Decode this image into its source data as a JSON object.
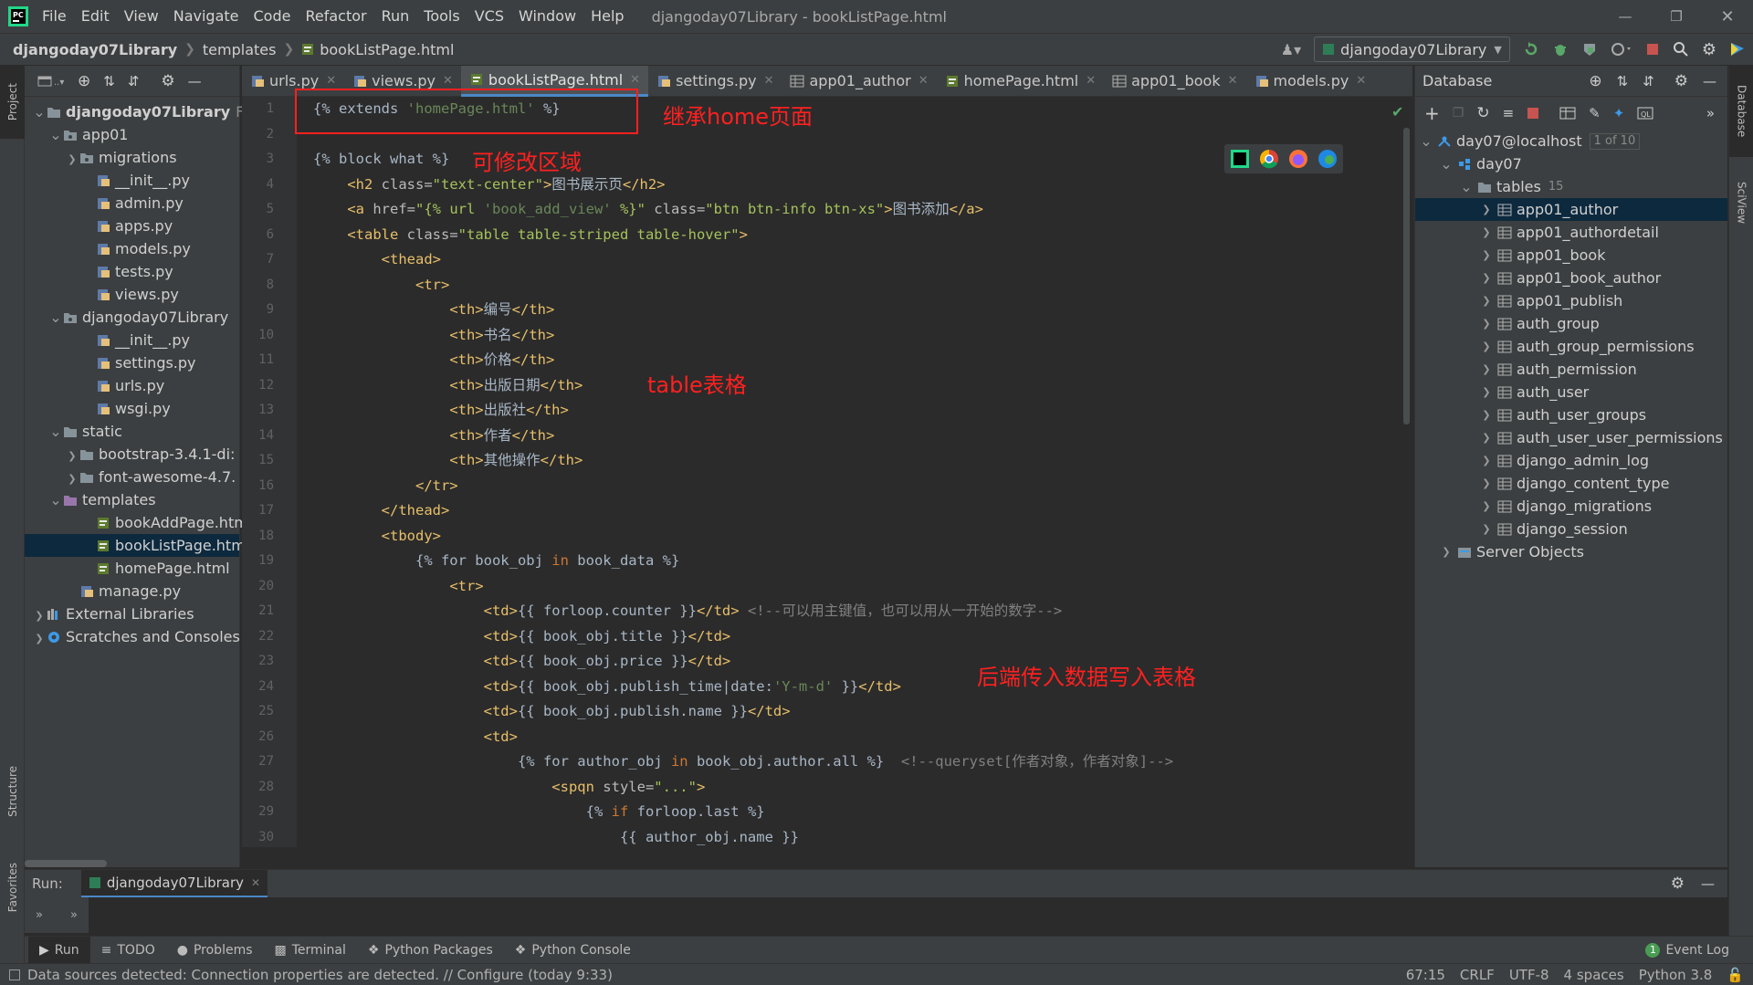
{
  "menu": [
    "File",
    "Edit",
    "View",
    "Navigate",
    "Code",
    "Refactor",
    "Run",
    "Tools",
    "VCS",
    "Window",
    "Help"
  ],
  "window_title": "djangoday07Library - bookListPage.html",
  "breadcrumb": [
    "djangoday07Library",
    "templates",
    "bookListPage.html"
  ],
  "run_config": "djangoday07Library",
  "left_strip": {
    "project": "Project",
    "structure": "Structure",
    "favorites": "Favorites"
  },
  "right_strip": {
    "database": "Database",
    "sciview": "SciView"
  },
  "project_tree": [
    {
      "label": "djangoday07Library",
      "suffix": "F:\\",
      "depth": 0,
      "arrow": "open",
      "icon": "folder-icon",
      "bold": true
    },
    {
      "label": "app01",
      "depth": 1,
      "arrow": "open",
      "icon": "package-icon"
    },
    {
      "label": "migrations",
      "depth": 2,
      "arrow": "closed",
      "icon": "package-icon"
    },
    {
      "label": "__init__.py",
      "depth": 3,
      "icon": "python-file-icon"
    },
    {
      "label": "admin.py",
      "depth": 3,
      "icon": "python-file-icon"
    },
    {
      "label": "apps.py",
      "depth": 3,
      "icon": "python-file-icon"
    },
    {
      "label": "models.py",
      "depth": 3,
      "icon": "python-file-icon"
    },
    {
      "label": "tests.py",
      "depth": 3,
      "icon": "python-file-icon"
    },
    {
      "label": "views.py",
      "depth": 3,
      "icon": "python-file-icon"
    },
    {
      "label": "djangoday07Library",
      "depth": 1,
      "arrow": "open",
      "icon": "package-icon"
    },
    {
      "label": "__init__.py",
      "depth": 3,
      "icon": "python-file-icon"
    },
    {
      "label": "settings.py",
      "depth": 3,
      "icon": "python-file-icon"
    },
    {
      "label": "urls.py",
      "depth": 3,
      "icon": "python-file-icon"
    },
    {
      "label": "wsgi.py",
      "depth": 3,
      "icon": "python-file-icon"
    },
    {
      "label": "static",
      "depth": 1,
      "arrow": "open",
      "icon": "folder-icon"
    },
    {
      "label": "bootstrap-3.4.1-di:",
      "depth": 2,
      "arrow": "closed",
      "icon": "folder-icon"
    },
    {
      "label": "font-awesome-4.7.",
      "depth": 2,
      "arrow": "closed",
      "icon": "folder-icon"
    },
    {
      "label": "templates",
      "depth": 1,
      "arrow": "open",
      "icon": "template-folder-icon"
    },
    {
      "label": "bookAddPage.htm",
      "depth": 3,
      "icon": "html-file-icon"
    },
    {
      "label": "bookListPage.html",
      "depth": 3,
      "icon": "html-file-icon",
      "selected": true
    },
    {
      "label": "homePage.html",
      "depth": 3,
      "icon": "html-file-icon"
    },
    {
      "label": "manage.py",
      "depth": 2,
      "icon": "python-file-icon"
    },
    {
      "label": "External Libraries",
      "depth": 0,
      "arrow": "closed",
      "icon": "library-icon"
    },
    {
      "label": "Scratches and Consoles",
      "depth": 0,
      "arrow": "closed",
      "icon": "scratches-icon"
    }
  ],
  "tabs": [
    {
      "label": "urls.py",
      "icon": "python-file-icon"
    },
    {
      "label": "views.py",
      "icon": "python-file-icon"
    },
    {
      "label": "bookListPage.html",
      "icon": "html-file-icon",
      "active": true
    },
    {
      "label": "settings.py",
      "icon": "python-file-icon"
    },
    {
      "label": "app01_author",
      "icon": "table-icon"
    },
    {
      "label": "homePage.html",
      "icon": "html-file-icon"
    },
    {
      "label": "app01_book",
      "icon": "table-icon"
    },
    {
      "label": "models.py",
      "icon": "python-file-icon"
    }
  ],
  "line_numbers": [
    "1",
    "2",
    "3",
    "4",
    "5",
    "6",
    "7",
    "8",
    "9",
    "10",
    "11",
    "12",
    "13",
    "14",
    "15",
    "16",
    "17",
    "18",
    "19",
    "20",
    "21",
    "22",
    "23",
    "24",
    "25",
    "26",
    "27",
    "28",
    "29",
    "30"
  ],
  "code_lines": [
    [
      [
        "t-tpl",
        "{% extends "
      ],
      [
        "t-str",
        "'homePage.html'"
      ],
      [
        "t-tpl",
        " %}"
      ]
    ],
    [],
    [
      [
        "t-tpl",
        "{% block what %}"
      ]
    ],
    [
      [
        "t-txt",
        "    "
      ],
      [
        "t-tag",
        "<h2 "
      ],
      [
        "t-attr",
        "class="
      ],
      [
        "t-val",
        "\"text-center\""
      ],
      [
        "t-tag",
        ">"
      ],
      [
        "t-txt",
        "图书展示页"
      ],
      [
        "t-tag",
        "</h2>"
      ]
    ],
    [
      [
        "t-txt",
        "    "
      ],
      [
        "t-tag",
        "<a "
      ],
      [
        "t-attr",
        "href="
      ],
      [
        "t-val",
        "\"{% url "
      ],
      [
        "t-str",
        "'book_add_view'"
      ],
      [
        "t-val",
        " %}\""
      ],
      [
        "t-attr",
        " class="
      ],
      [
        "t-val",
        "\"btn btn-info btn-xs\""
      ],
      [
        "t-tag",
        ">"
      ],
      [
        "t-txt",
        "图书添加"
      ],
      [
        "t-tag",
        "</a>"
      ]
    ],
    [
      [
        "t-txt",
        "    "
      ],
      [
        "t-tag",
        "<table "
      ],
      [
        "t-attr",
        "class="
      ],
      [
        "t-val",
        "\"table table-striped table-hover\""
      ],
      [
        "t-tag",
        ">"
      ]
    ],
    [
      [
        "t-txt",
        "        "
      ],
      [
        "t-tag",
        "<thead>"
      ]
    ],
    [
      [
        "t-txt",
        "            "
      ],
      [
        "t-tag",
        "<tr>"
      ]
    ],
    [
      [
        "t-txt",
        "                "
      ],
      [
        "t-tag",
        "<th>"
      ],
      [
        "t-txt",
        "编号"
      ],
      [
        "t-tag",
        "</th>"
      ]
    ],
    [
      [
        "t-txt",
        "                "
      ],
      [
        "t-tag",
        "<th>"
      ],
      [
        "t-txt",
        "书名"
      ],
      [
        "t-tag",
        "</th>"
      ]
    ],
    [
      [
        "t-txt",
        "                "
      ],
      [
        "t-tag",
        "<th>"
      ],
      [
        "t-txt",
        "价格"
      ],
      [
        "t-tag",
        "</th>"
      ]
    ],
    [
      [
        "t-txt",
        "                "
      ],
      [
        "t-tag",
        "<th>"
      ],
      [
        "t-txt",
        "出版日期"
      ],
      [
        "t-tag",
        "</th>"
      ]
    ],
    [
      [
        "t-txt",
        "                "
      ],
      [
        "t-tag",
        "<th>"
      ],
      [
        "t-txt",
        "出版社"
      ],
      [
        "t-tag",
        "</th>"
      ]
    ],
    [
      [
        "t-txt",
        "                "
      ],
      [
        "t-tag",
        "<th>"
      ],
      [
        "t-txt",
        "作者"
      ],
      [
        "t-tag",
        "</th>"
      ]
    ],
    [
      [
        "t-txt",
        "                "
      ],
      [
        "t-tag",
        "<th>"
      ],
      [
        "t-txt",
        "其他操作"
      ],
      [
        "t-tag",
        "</th>"
      ]
    ],
    [
      [
        "t-txt",
        "            "
      ],
      [
        "t-tag",
        "</tr>"
      ]
    ],
    [
      [
        "t-txt",
        "        "
      ],
      [
        "t-tag",
        "</thead>"
      ]
    ],
    [
      [
        "t-txt",
        "        "
      ],
      [
        "t-tag",
        "<tbody>"
      ]
    ],
    [
      [
        "t-txt",
        "            "
      ],
      [
        "t-tpl",
        "{% for book_obj "
      ],
      [
        "t-kw",
        "in"
      ],
      [
        "t-tpl",
        " book_data %}"
      ]
    ],
    [
      [
        "t-txt",
        "                "
      ],
      [
        "t-tag",
        "<tr>"
      ]
    ],
    [
      [
        "t-txt",
        "                    "
      ],
      [
        "t-tag",
        "<td>"
      ],
      [
        "t-tpl",
        "{{ forloop.counter }}"
      ],
      [
        "t-tag",
        "</td>"
      ],
      [
        "t-cmt",
        " <!--可以用主键值，也可以用从一开始的数字-->"
      ]
    ],
    [
      [
        "t-txt",
        "                    "
      ],
      [
        "t-tag",
        "<td>"
      ],
      [
        "t-tpl",
        "{{ book_obj.title }}"
      ],
      [
        "t-tag",
        "</td>"
      ]
    ],
    [
      [
        "t-txt",
        "                    "
      ],
      [
        "t-tag",
        "<td>"
      ],
      [
        "t-tpl",
        "{{ book_obj.price }}"
      ],
      [
        "t-tag",
        "</td>"
      ]
    ],
    [
      [
        "t-txt",
        "                    "
      ],
      [
        "t-tag",
        "<td>"
      ],
      [
        "t-tpl",
        "{{ book_obj.publish_time|date:"
      ],
      [
        "t-str",
        "'Y-m-d'"
      ],
      [
        "t-tpl",
        " }}"
      ],
      [
        "t-tag",
        "</td>"
      ]
    ],
    [
      [
        "t-txt",
        "                    "
      ],
      [
        "t-tag",
        "<td>"
      ],
      [
        "t-tpl",
        "{{ book_obj.publish.name }}"
      ],
      [
        "t-tag",
        "</td>"
      ]
    ],
    [
      [
        "t-txt",
        "                    "
      ],
      [
        "t-tag",
        "<td>"
      ]
    ],
    [
      [
        "t-txt",
        "                        "
      ],
      [
        "t-tpl",
        "{% for author_obj "
      ],
      [
        "t-kw",
        "in"
      ],
      [
        "t-tpl",
        " book_obj.author.all %}"
      ],
      [
        "t-cmt",
        "  <!--queryset[作者对象，作者对象]-->"
      ]
    ],
    [
      [
        "t-txt",
        "                            "
      ],
      [
        "t-tag",
        "<spqn "
      ],
      [
        "t-attr",
        "style="
      ],
      [
        "t-val",
        "\"...\""
      ],
      [
        "t-tag",
        ">"
      ]
    ],
    [
      [
        "t-txt",
        "                                "
      ],
      [
        "t-tpl",
        "{% "
      ],
      [
        "t-kw",
        "if"
      ],
      [
        "t-tpl",
        " forloop.last %}"
      ]
    ],
    [
      [
        "t-txt",
        "                                    "
      ],
      [
        "t-tpl",
        "{{ author_obj.name }}"
      ]
    ]
  ],
  "annotations": {
    "extends_note": "继承home页面",
    "block_note": "可修改区域",
    "table_note": "table表格",
    "backend_note": "后端传入数据写入表格"
  },
  "database": {
    "title": "Database",
    "connection": "day07@localhost",
    "connection_badge": "1 of 10",
    "schema": "day07",
    "tables_label": "tables",
    "tables_count": "15",
    "tables": [
      "app01_author",
      "app01_authordetail",
      "app01_book",
      "app01_book_author",
      "app01_publish",
      "auth_group",
      "auth_group_permissions",
      "auth_permission",
      "auth_user",
      "auth_user_groups",
      "auth_user_user_permissions",
      "django_admin_log",
      "django_content_type",
      "django_migrations",
      "django_session"
    ],
    "server_objects": "Server Objects"
  },
  "run_panel": {
    "label": "Run:",
    "tab": "djangoday07Library"
  },
  "bottom_tabs": [
    "Run",
    "TODO",
    "Problems",
    "Terminal",
    "Python Packages",
    "Python Console"
  ],
  "event_log": "Event Log",
  "event_log_count": "1",
  "status": {
    "message": "Data sources detected: Connection properties are detected. // Configure (today 9:33)",
    "position": "67:15",
    "line_sep": "CRLF",
    "encoding": "UTF-8",
    "indent": "4 spaces",
    "interpreter": "Python 3.8"
  },
  "colors": {
    "accent": "#4a88c7",
    "annotation": "#ff2020",
    "selection": "#0d293e"
  }
}
